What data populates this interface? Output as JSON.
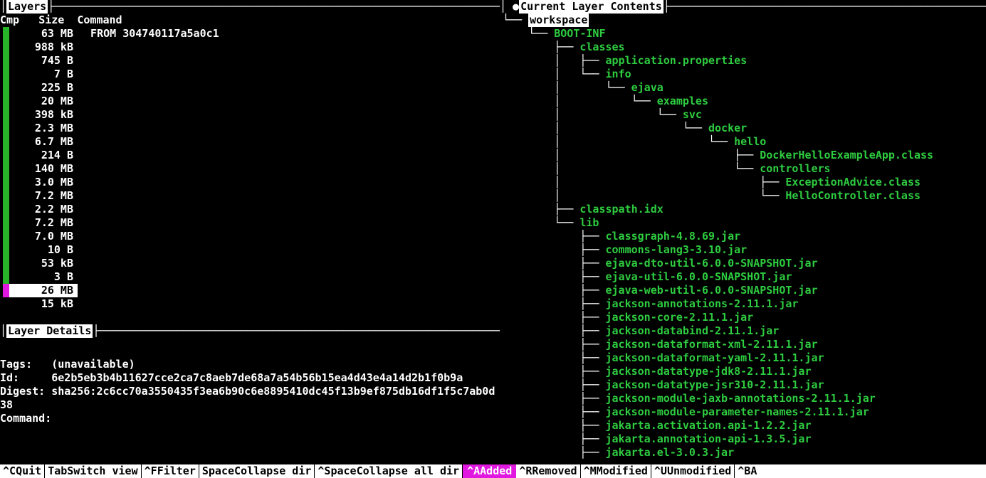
{
  "panels": {
    "layers_title": "Layers",
    "layer_contents_title": "Current Layer Contents",
    "layer_details_title": "Layer Details"
  },
  "layers": {
    "header": {
      "cmp": "Cmp",
      "size": "Size",
      "command": "Command"
    },
    "rows": [
      {
        "cmp": "green",
        "size": " 63 MB",
        "cmd": "FROM 304740117a5a0c1"
      },
      {
        "cmp": "green",
        "size": "988 kB",
        "cmd": ""
      },
      {
        "cmp": "green",
        "size": " 745 B",
        "cmd": ""
      },
      {
        "cmp": "green",
        "size": "   7 B",
        "cmd": ""
      },
      {
        "cmp": "green",
        "size": " 225 B",
        "cmd": ""
      },
      {
        "cmp": "green",
        "size": " 20 MB",
        "cmd": ""
      },
      {
        "cmp": "green",
        "size": "398 kB",
        "cmd": ""
      },
      {
        "cmp": "green",
        "size": "2.3 MB",
        "cmd": ""
      },
      {
        "cmp": "green",
        "size": "6.7 MB",
        "cmd": ""
      },
      {
        "cmp": "green",
        "size": " 214 B",
        "cmd": ""
      },
      {
        "cmp": "green",
        "size": "140 MB",
        "cmd": ""
      },
      {
        "cmp": "green",
        "size": "3.0 MB",
        "cmd": ""
      },
      {
        "cmp": "green",
        "size": "7.2 MB",
        "cmd": ""
      },
      {
        "cmp": "green",
        "size": "2.2 MB",
        "cmd": ""
      },
      {
        "cmp": "green",
        "size": "7.2 MB",
        "cmd": ""
      },
      {
        "cmp": "green",
        "size": "7.0 MB",
        "cmd": ""
      },
      {
        "cmp": "green",
        "size": "  10 B",
        "cmd": ""
      },
      {
        "cmp": "green",
        "size": " 53 kB",
        "cmd": ""
      },
      {
        "cmp": "green",
        "size": "   3 B",
        "cmd": ""
      },
      {
        "cmp": "magenta",
        "size": " 26 MB",
        "cmd": "",
        "selected": true
      },
      {
        "cmp": "none",
        "size": " 15 kB",
        "cmd": ""
      }
    ]
  },
  "details": {
    "tags_label": "Tags:",
    "tags_value": "(unavailable)",
    "id_label": "Id:",
    "id_value": "6e2b5eb3b4b11627cce2ca7c8aeb7de68a7a54b56b15ea4d43e4a14d2b1f0b9a",
    "digest_label": "Digest:",
    "digest_value": "sha256:2c6cc70a3550435f3ea6b90c6e8895410dc45f13b9ef875db16df1f5c7ab0d38",
    "command_label": "Command:",
    "command_value": ""
  },
  "tree": {
    "root": "workspace",
    "lines": [
      {
        "branch": "└── ",
        "name": "BOOT-INF"
      },
      {
        "branch": "    ├── ",
        "name": "classes"
      },
      {
        "branch": "    │   ├── ",
        "name": "application.properties"
      },
      {
        "branch": "    │   └── ",
        "name": "info"
      },
      {
        "branch": "    │       └── ",
        "name": "ejava"
      },
      {
        "branch": "    │           └── ",
        "name": "examples"
      },
      {
        "branch": "    │               └── ",
        "name": "svc"
      },
      {
        "branch": "    │                   └── ",
        "name": "docker"
      },
      {
        "branch": "    │                       └── ",
        "name": "hello"
      },
      {
        "branch": "    │                           ├── ",
        "name": "DockerHelloExampleApp.class"
      },
      {
        "branch": "    │                           └── ",
        "name": "controllers"
      },
      {
        "branch": "    │                               ├── ",
        "name": "ExceptionAdvice.class"
      },
      {
        "branch": "    │                               └── ",
        "name": "HelloController.class"
      },
      {
        "branch": "    ├── ",
        "name": "classpath.idx"
      },
      {
        "branch": "    └── ",
        "name": "lib"
      },
      {
        "branch": "        ├── ",
        "name": "classgraph-4.8.69.jar"
      },
      {
        "branch": "        ├── ",
        "name": "commons-lang3-3.10.jar"
      },
      {
        "branch": "        ├── ",
        "name": "ejava-dto-util-6.0.0-SNAPSHOT.jar"
      },
      {
        "branch": "        ├── ",
        "name": "ejava-util-6.0.0-SNAPSHOT.jar"
      },
      {
        "branch": "        ├── ",
        "name": "ejava-web-util-6.0.0-SNAPSHOT.jar"
      },
      {
        "branch": "        ├── ",
        "name": "jackson-annotations-2.11.1.jar"
      },
      {
        "branch": "        ├── ",
        "name": "jackson-core-2.11.1.jar"
      },
      {
        "branch": "        ├── ",
        "name": "jackson-databind-2.11.1.jar"
      },
      {
        "branch": "        ├── ",
        "name": "jackson-dataformat-xml-2.11.1.jar"
      },
      {
        "branch": "        ├── ",
        "name": "jackson-dataformat-yaml-2.11.1.jar"
      },
      {
        "branch": "        ├── ",
        "name": "jackson-datatype-jdk8-2.11.1.jar"
      },
      {
        "branch": "        ├── ",
        "name": "jackson-datatype-jsr310-2.11.1.jar"
      },
      {
        "branch": "        ├── ",
        "name": "jackson-module-jaxb-annotations-2.11.1.jar"
      },
      {
        "branch": "        ├── ",
        "name": "jackson-module-parameter-names-2.11.1.jar"
      },
      {
        "branch": "        ├── ",
        "name": "jakarta.activation.api-1.2.2.jar"
      },
      {
        "branch": "        ├── ",
        "name": "jakarta.annotation-api-1.3.5.jar"
      },
      {
        "branch": "        ├── ",
        "name": "jakarta.el-3.0.3.jar"
      }
    ]
  },
  "statusbar": {
    "items": [
      {
        "key": "^C",
        "label": "Quit"
      },
      {
        "key": "Tab",
        "label": "Switch view"
      },
      {
        "key": "^F",
        "label": "Filter"
      },
      {
        "key": "Space",
        "label": "Collapse dir"
      },
      {
        "key": "^Space",
        "label": "Collapse all dir"
      },
      {
        "key": "^A",
        "label": "Added",
        "style": "added"
      },
      {
        "key": "^R",
        "label": "Removed"
      },
      {
        "key": "^M",
        "label": "Modified"
      },
      {
        "key": "^U",
        "label": "Unmodified"
      },
      {
        "key": "^B",
        "label": "A"
      }
    ]
  }
}
